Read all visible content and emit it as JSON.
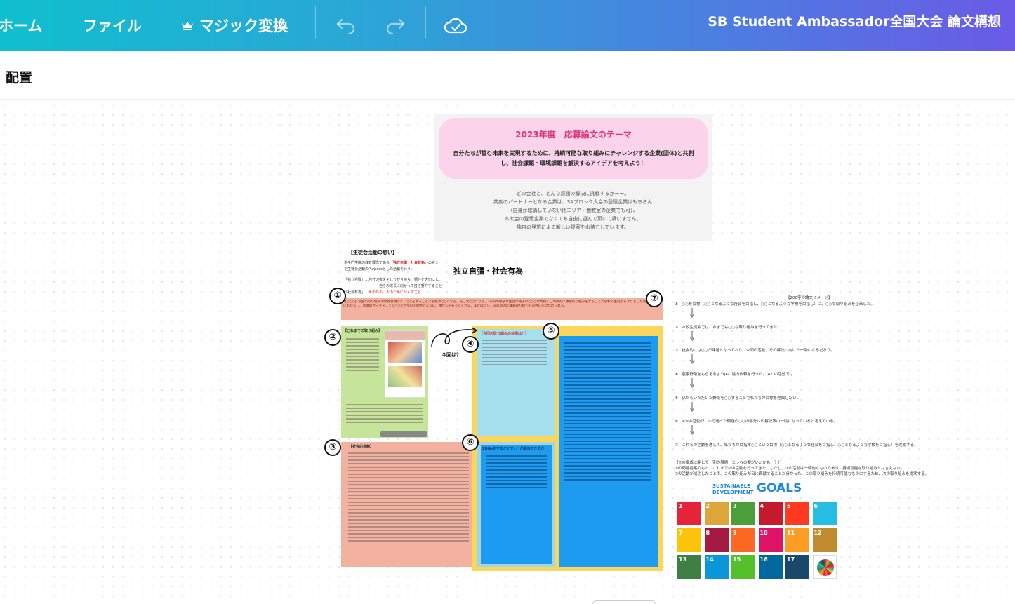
{
  "topbar": {
    "home": "ホーム",
    "file": "ファイル",
    "magic": "マジック変換",
    "title": "SB Student Ambassador全国大会 論文構想",
    "icons": [
      "crown-icon",
      "undo-icon",
      "redo-icon",
      "cloud-saved-icon"
    ]
  },
  "subbar": {
    "label": "配置"
  },
  "theme": {
    "title": "2023年度　応募論文のテーマ",
    "text": "自分たちが望む未来を実現するために、持続可能な取り組みにチャレンジする企業(団体)と共創し、社会課題・環境課題を解決するアイデアを考えよう！",
    "body": [
      "どの会社と、どんな課題の解決に挑戦するかーー。",
      "共創のパートナーとなる企業は、SAブロック大会の登壇企業はもちろん",
      "（自身が聴講していない他エリア・他教室の企業でも可）、",
      "本大会の登壇企業でなくても自由に選んで頂いて構いません。",
      "独自の発想による新しい提案をお待ちしています。"
    ]
  },
  "sheet": {
    "heading": "【生徒会活動の想い】",
    "intro1_a": "追手門学院の教育理念である「",
    "intro1_red": "独立自彊・社会有為",
    "intro1_b": "」の考え",
    "intro2": "を生徒会活動のPurposeとした活動を行う。",
    "def1": "「独立自彊」…自分の考えをしっかり持ち、個性を大切にし、",
    "def1b": "自らの成長に向かって自ら努力すること",
    "def2_a": "「社会有為」…",
    "def2_red": "世のため、人のために尽くすこと",
    "motto": "独立自彊・社会有為",
    "today": "今回は？",
    "block1": "【○○○】今回の取り組みの問題意識は？　○○をすることで学校が○○になる。そこが○○になる。（学校の様子や生徒の様子の○○○が問題）この目的に課題取り組みをすることで学校の生徒からよりとした新習慣結果にもなるし、意識のカマタをこえて○○○が学の人の中のように、独立心をもってくれる。または自ら、次の目的に課題取り組む方向性にもつなげられる。",
    "block2_title": "【これまでの取り組み】",
    "block3_title": "【社会的意義】",
    "block4_title": "【今回の取り組みの目標は？】",
    "block6_title": "SDGsをすることで○○が解決できるか",
    "right_title": "【200字の論文イメージ】",
    "steps": [
      "①　○○を目標（○○となるような社会を目指し、○○となるような学校を目指し）に、○○な取り組みを企画した。",
      "②　本校生徒会ではこれまでも○○な取り組みを行ってきた。",
      "③　社会的には○○が課題となっており、今回の活動、その解決に向けた一助になるだろう。",
      "④　農家野菜をもらえるようJAに協力依頼を行った。JAとの活動では…",
      "⑤　JAからいただいた野菜を○○することで私たちの目標を達成したい。",
      "⑥　④⑤の活動が、⑤で述べた問題の○○の部分への解決策の一助になっていると考えている。",
      "⑦　これらの活動を通して、私たちが目指す○○という目標（○○となるような社会を目指し、○○となるような学校を目指し）を達成する。"
    ],
    "note1": "【⑦の構成に関して　別の展開（こっちの案がいいかも！？）】",
    "note2": "⑤の問題提案のもと、これまで⑦の活動を行ってきた。しかし、⑦の活動は一時的なものであり、持続可能な取り組みとは言えない。",
    "note3": "⑦の活動が成功したことで、この取り組みが日に貢献することが分かった。この取り組みを持続可能なものにするため、次の取り組みを提案する。",
    "markers": [
      "①",
      "②",
      "③",
      "④",
      "⑤",
      "⑥",
      "⑦"
    ]
  },
  "sdg": {
    "title1": "SUSTAINABLE",
    "title2": "DEVELOPMENT",
    "goals": "GOALS",
    "tiles": [
      {
        "n": "1",
        "c": "#e5243b"
      },
      {
        "n": "2",
        "c": "#dda63a"
      },
      {
        "n": "3",
        "c": "#4c9f38"
      },
      {
        "n": "4",
        "c": "#c5192d"
      },
      {
        "n": "5",
        "c": "#ff3a21"
      },
      {
        "n": "6",
        "c": "#26bde2"
      },
      {
        "n": "7",
        "c": "#fcc30b"
      },
      {
        "n": "8",
        "c": "#a21942"
      },
      {
        "n": "9",
        "c": "#fd6925"
      },
      {
        "n": "10",
        "c": "#dd1367"
      },
      {
        "n": "11",
        "c": "#fd9d24"
      },
      {
        "n": "12",
        "c": "#bf8b2e"
      },
      {
        "n": "13",
        "c": "#3f7e44"
      },
      {
        "n": "14",
        "c": "#0a97d9"
      },
      {
        "n": "15",
        "c": "#56c02b"
      },
      {
        "n": "16",
        "c": "#00689d"
      },
      {
        "n": "17",
        "c": "#19486a"
      },
      {
        "n": "",
        "c": "#ffffff"
      }
    ]
  }
}
